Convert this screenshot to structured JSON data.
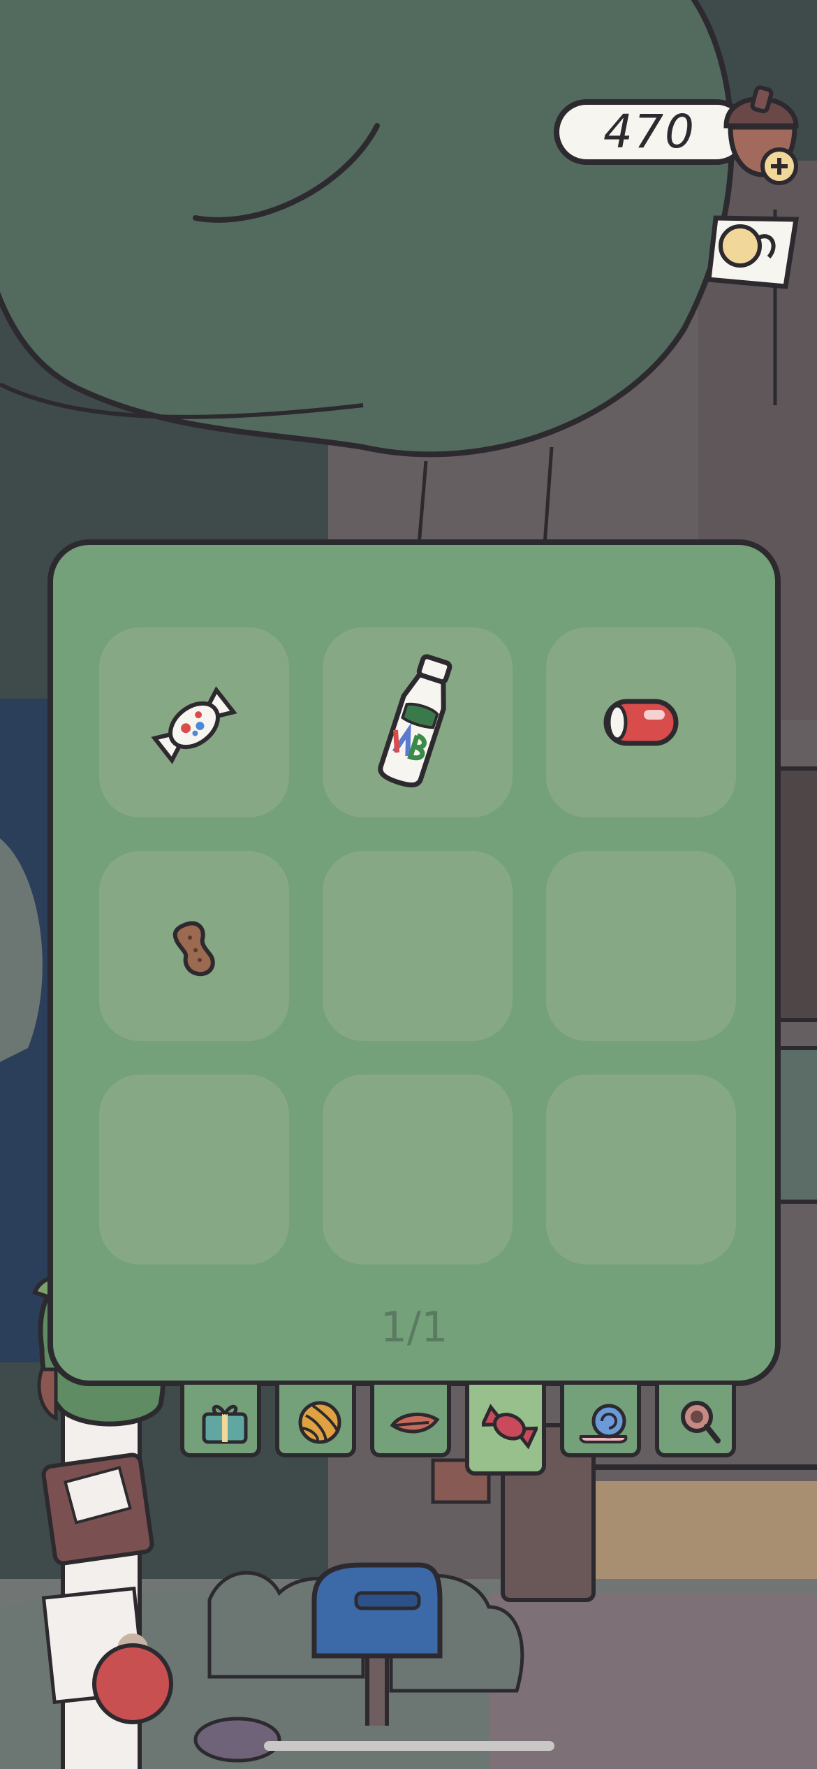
{
  "hud": {
    "currency_value": "470",
    "currency_icon": "acorn-icon",
    "add_icon": "plus-icon",
    "note_icon": "note-icon"
  },
  "inventory": {
    "page_indicator": "1/1",
    "slots": [
      {
        "item": "wrapped-candy-icon"
      },
      {
        "item": "milk-bottle-icon"
      },
      {
        "item": "soda-can-icon"
      },
      {
        "item": "peanut-icon"
      },
      {
        "item": ""
      },
      {
        "item": ""
      },
      {
        "item": ""
      },
      {
        "item": ""
      },
      {
        "item": ""
      }
    ]
  },
  "tabs": [
    {
      "icon": "gift-icon",
      "active": false
    },
    {
      "icon": "yarn-ball-icon",
      "active": false
    },
    {
      "icon": "leaf-icon",
      "active": false
    },
    {
      "icon": "candy-icon",
      "active": true
    },
    {
      "icon": "snail-icon",
      "active": false
    },
    {
      "icon": "magnifier-icon",
      "active": false
    }
  ],
  "colors": {
    "panel": "#74a07a",
    "slot": "#87a884",
    "active_tab": "#98c08c",
    "outline": "#2d2a2f",
    "foliage": "#536b5f"
  }
}
